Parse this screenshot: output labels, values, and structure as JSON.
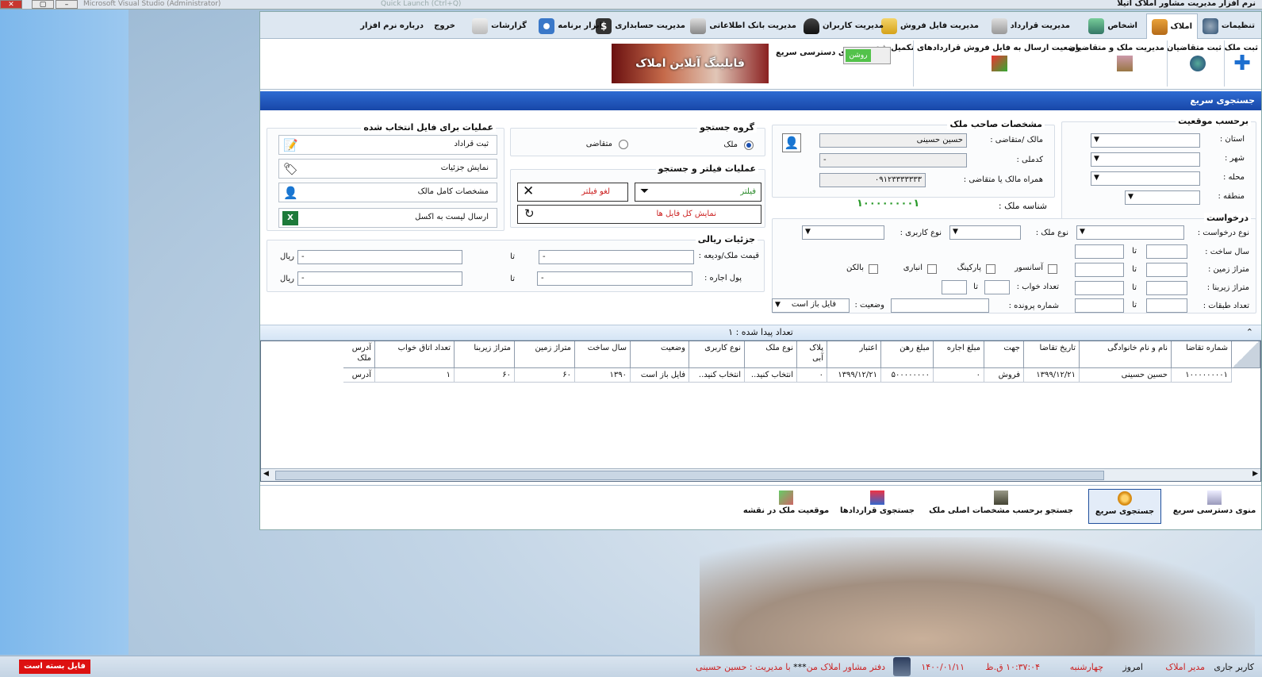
{
  "window": {
    "title": "نرم افزار مدیریت مشاور املاک آتیلا",
    "ghost_title": "Microsoft Visual Studio (Administrator)",
    "ghost_title2": "Quick Launch (Ctrl+Q)"
  },
  "tabs": [
    {
      "label": "تنظیمات"
    },
    {
      "label": "املاک"
    },
    {
      "label": "اشخاص"
    },
    {
      "label": "مدیریت قرارداد"
    },
    {
      "label": "مدیریت فایل فروش"
    },
    {
      "label": "مدیریت کاربران"
    },
    {
      "label": "مدیریت بانک اطلاعاتی"
    },
    {
      "label": "مدیریت حسابداری"
    },
    {
      "label": "ابزار برنامه"
    },
    {
      "label": "گزارشات"
    },
    {
      "label": "خروج"
    },
    {
      "label": "درباره نرم افزار"
    }
  ],
  "ribbon": {
    "register_property": "ثبت ملک",
    "register_applicants": "ثبت متقاضیان",
    "manage_property_applicants": "مدیریت ملک و متقاضیان",
    "send_status": "وضعیت ارسال به فایل فروش قراردادهای تکمیل شده",
    "quick_menu_label": "منوی دسترسی سریع",
    "toggle_text": "روشن",
    "banner_text": "فایلینگ آنلاین املاک"
  },
  "panel_title": "جستجوی سریع",
  "location": {
    "title": "برحسب موقعیت",
    "province": "استان :",
    "city": "شهر :",
    "area": "محله :",
    "region": "منطقه :"
  },
  "owner": {
    "title": "مشخصات صاحب ملک",
    "owner_label": "مالک /متقاضی :",
    "owner_value": "حسین حسینی",
    "code_label": "کدملی :",
    "code_value": "-",
    "mobile_label": "همراه مالک یا متقاضی :",
    "mobile_value": "۰۹۱۲۳۳۳۳۳۳۳",
    "id_label": "شناسه ملک :",
    "id_value": "۱۰۰۰۰۰۰۰۰۱"
  },
  "search_group": {
    "title": "گروه جستجو",
    "opt_property": "ملک",
    "opt_applicant": "متقاضی"
  },
  "filter_ops": {
    "title": "عملیات فیلتر و جستجو",
    "filter": "فیلتر",
    "cancel_filter": "لغو فیلتر",
    "show_all": "نمایش کل فایل ها"
  },
  "file_ops": {
    "title": "عملیات برای فایل انتخاب شده",
    "contract": "ثبت قراداد",
    "details": "نمایش جزئیات",
    "owner_full": "مشخصات کامل مالک",
    "excel": "ارسال لیست به اکسل"
  },
  "request": {
    "title": "درخواست",
    "request_type": "نوع درخواست :",
    "property_type": "نوع ملک :",
    "usage_type": "نوع کاربری :",
    "build_year": "سال ساخت :",
    "land_area": "متراژ زمین :",
    "built_area": "متراژ زیربنا :",
    "floors": "تعداد طبقات :",
    "bedrooms": "تعداد خواب :",
    "case_no": "شماره پرونده :",
    "status": "وضعیت :",
    "status_value": "فایل باز است",
    "to": "تا",
    "elevator": "آسانسور",
    "parking": "پارکینگ",
    "storage": "انباری",
    "balcony": "بالکن"
  },
  "rial": {
    "title": "جزئیات ریالی",
    "price": "قیمت ملک/ودیعه :",
    "rent": "پول اجاره :",
    "to": "تا",
    "currency": "ریال",
    "dash": "-"
  },
  "result_count": "تعداد پیدا شده : ۱",
  "table": {
    "columns": [
      "شماره تقاضا",
      "نام و نام خانوادگی",
      "تاریخ تقاضا",
      "جهت",
      "مبلغ اجاره",
      "مبلغ رهن",
      "اعتبار",
      "پلاک آبی",
      "نوع ملک",
      "نوع کاربری",
      "وضعیت",
      "سال ساخت",
      "متراژ زمین",
      "متراژ زیربنا",
      "تعداد اتاق خواب",
      "آدرس ملک"
    ],
    "row": [
      "۱۰۰۰۰۰۰۰۰۱",
      "حسین حسینی",
      "۱۳۹۹/۱۲/۲۱",
      "فروش",
      "۰",
      "۵۰۰۰۰۰۰۰۰",
      "۱۳۹۹/۱۲/۲۱",
      "۰",
      "انتخاب کنید..",
      "انتخاب کنید..",
      "فایل باز است",
      "۱۳۹۰",
      "۶۰",
      "۶۰",
      "۱",
      "آدرس"
    ]
  },
  "bottom_nav": {
    "quick_menu": "منوی دسترسی سریع",
    "quick_search": "جستجوی سریع",
    "search_main": "جستجو برحسب مشخصات اصلی ملک",
    "search_contracts": "جستجوی قراردادها",
    "map": "موقعیت ملک در نقشه"
  },
  "status": {
    "current_user_label": "کاربر جاری",
    "current_user": "مدیر املاک",
    "today_label": "امروز",
    "weekday": "چهارشنبه",
    "time": "۱۰:۳۷:۰۴ ق.ظ",
    "date": "۱۴۰۰/۰۱/۱۱",
    "office_prefix": "دفتر مشاور املاک من",
    "office_stars": "***",
    "office_suffix": "با مدیریت : حسین حسینی",
    "file_closed": "فایل بسته است"
  },
  "colors": {
    "accent": "#1847a8",
    "status_red": "#dd1111",
    "toggle_green": "#53c24a"
  }
}
